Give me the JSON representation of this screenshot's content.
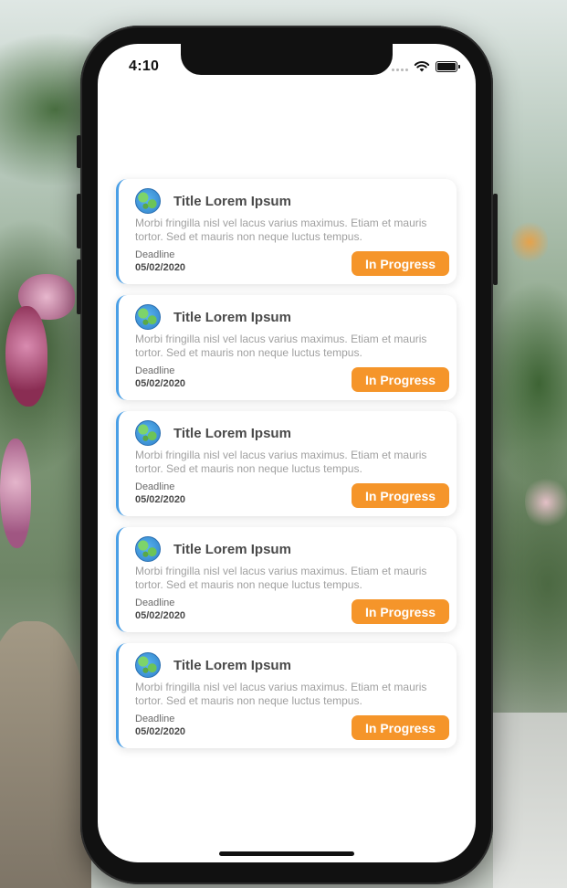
{
  "status_bar": {
    "time": "4:10"
  },
  "task_list": {
    "cards": [
      {
        "icon": "globe-icon",
        "title": "Title Lorem Ipsum",
        "description": "Morbi fringilla nisl vel lacus varius maximus. Etiam et mauris tortor. Sed et mauris non neque luctus tempus.",
        "deadline_label": "Deadline",
        "deadline_date": "05/02/2020",
        "status_label": "In Progress"
      },
      {
        "icon": "globe-icon",
        "title": "Title Lorem Ipsum",
        "description": "Morbi fringilla nisl vel lacus varius maximus. Etiam et mauris tortor. Sed et mauris non neque luctus tempus.",
        "deadline_label": "Deadline",
        "deadline_date": "05/02/2020",
        "status_label": "In Progress"
      },
      {
        "icon": "globe-icon",
        "title": "Title Lorem Ipsum",
        "description": "Morbi fringilla nisl vel lacus varius maximus. Etiam et mauris tortor. Sed et mauris non neque luctus tempus.",
        "deadline_label": "Deadline",
        "deadline_date": "05/02/2020",
        "status_label": "In Progress"
      },
      {
        "icon": "globe-icon",
        "title": "Title Lorem Ipsum",
        "description": "Morbi fringilla nisl vel lacus varius maximus. Etiam et mauris tortor. Sed et mauris non neque luctus tempus.",
        "deadline_label": "Deadline",
        "deadline_date": "05/02/2020",
        "status_label": "In Progress"
      },
      {
        "icon": "globe-icon",
        "title": "Title Lorem Ipsum",
        "description": "Morbi fringilla nisl vel lacus varius maximus. Etiam et mauris tortor. Sed et mauris non neque luctus tempus.",
        "deadline_label": "Deadline",
        "deadline_date": "05/02/2020",
        "status_label": "In Progress"
      }
    ]
  },
  "colors": {
    "accent_border": "#4a9fe6",
    "status_button": "#f5952a"
  }
}
